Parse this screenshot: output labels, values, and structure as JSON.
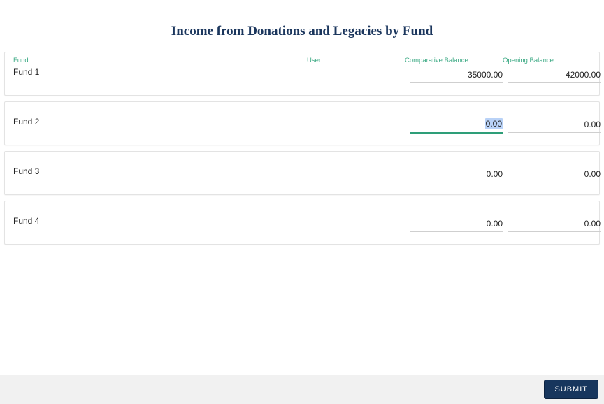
{
  "title": "Income from Donations and Legacies by Fund",
  "headers": {
    "fund": "Fund",
    "user": "User",
    "comparative": "Comparative Balance",
    "opening": "Opening Balance"
  },
  "rows": [
    {
      "name": "Fund 1",
      "comparative": "35000.00",
      "opening": "42000.00",
      "active": false
    },
    {
      "name": "Fund 2",
      "comparative": "0.00",
      "opening": "0.00",
      "active": true
    },
    {
      "name": "Fund 3",
      "comparative": "0.00",
      "opening": "0.00",
      "active": false
    },
    {
      "name": "Fund 4",
      "comparative": "0.00",
      "opening": "0.00",
      "active": false
    }
  ],
  "submit_label": "SUBMIT"
}
